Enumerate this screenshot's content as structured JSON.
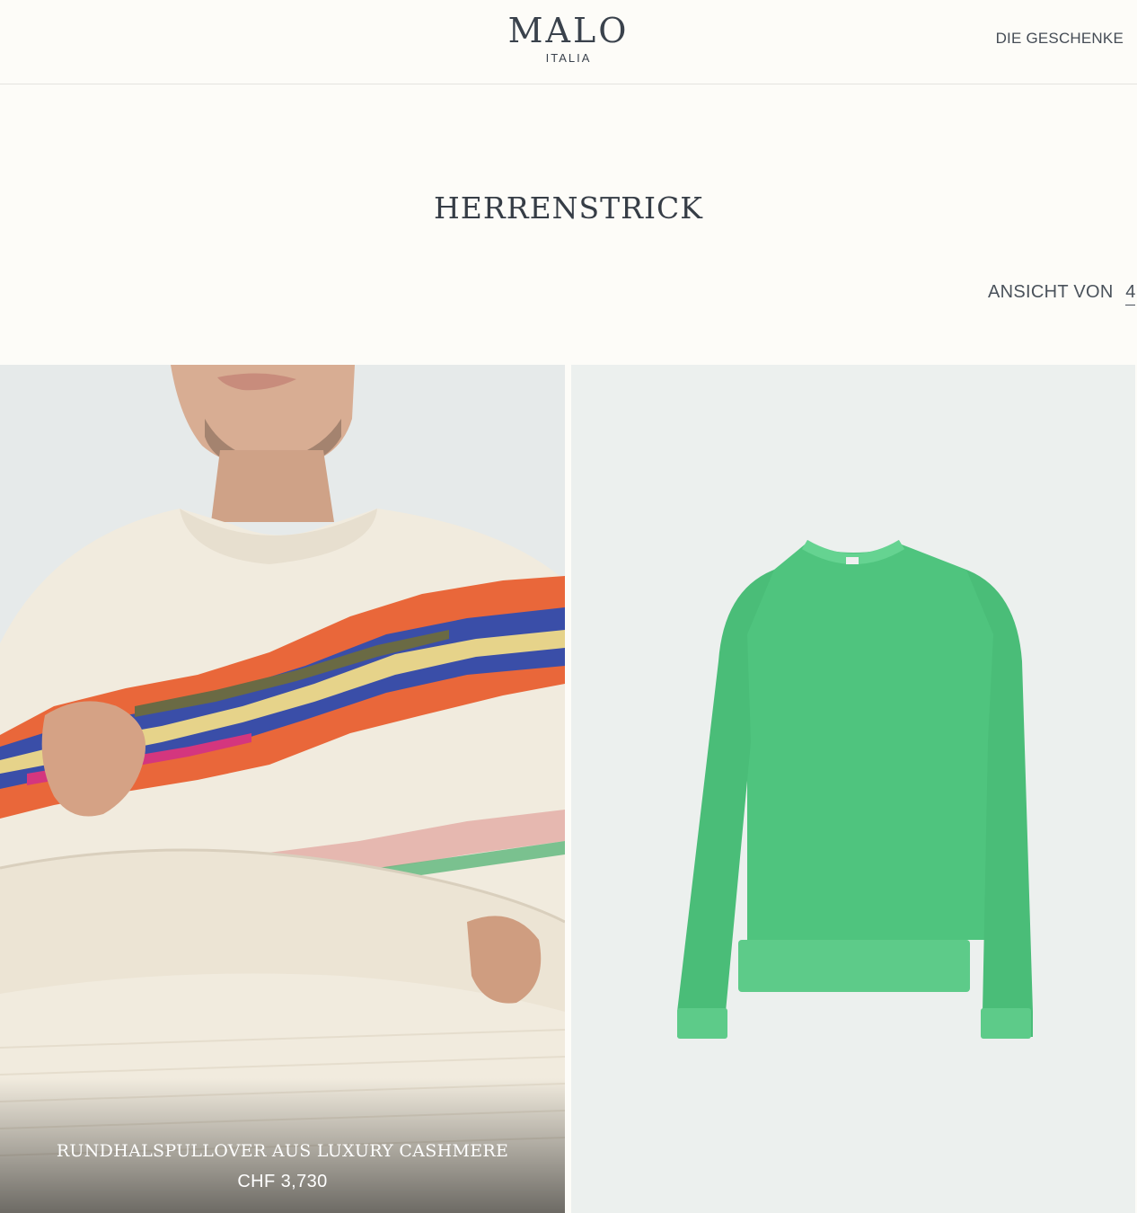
{
  "header": {
    "logo_main": "MALO",
    "logo_sub": "ITALIA",
    "gifts_link": "DIE GESCHENKE"
  },
  "page": {
    "title": "HERRENSTRICK"
  },
  "view_control": {
    "label": "ANSICHT VON",
    "value": "4"
  },
  "products": [
    {
      "name": "RUNDHALSPULLOVER AUS LUXURY CASHMERE",
      "price": "CHF 3,730",
      "color": "#f1ebde"
    },
    {
      "color": "#4fc47e"
    }
  ],
  "colors": {
    "background": "#fdfcf8",
    "text": "#3a414a",
    "card_bg": "#ecf0ee"
  }
}
